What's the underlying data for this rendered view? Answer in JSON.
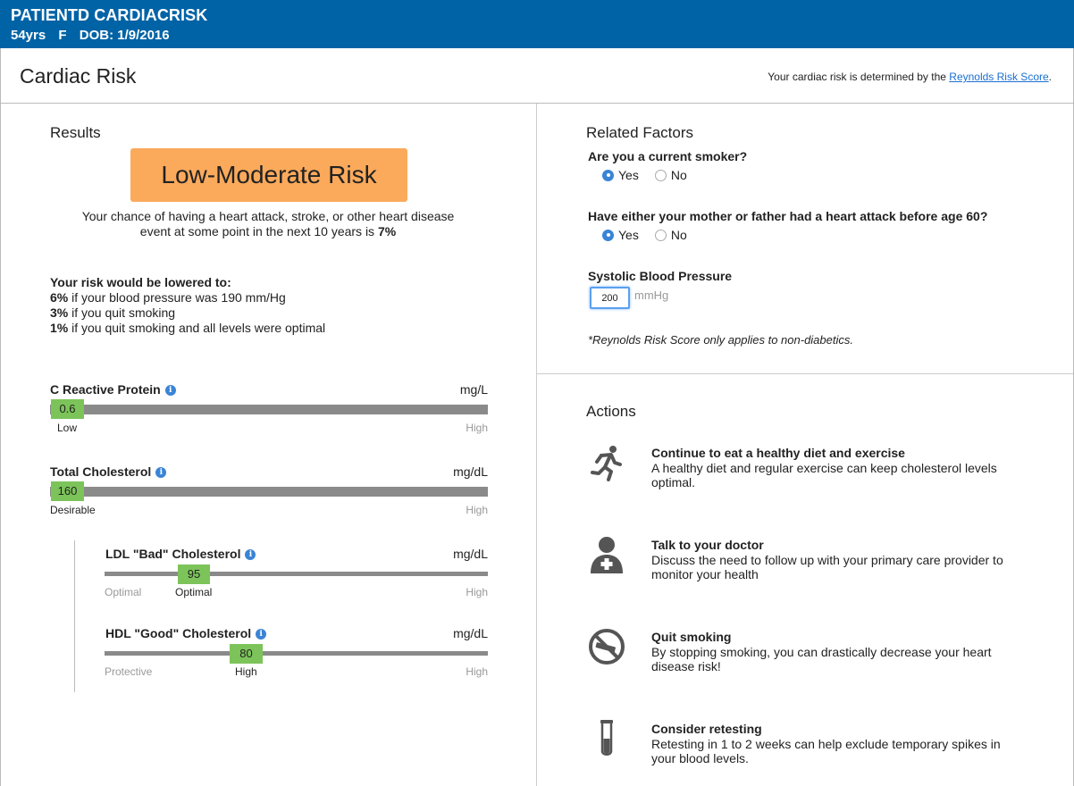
{
  "patient": {
    "name": "PATIENTD CARDIACRISK",
    "age": "54yrs",
    "sex": "F",
    "dob": "DOB: 1/9/2016"
  },
  "page": {
    "title": "Cardiac Risk",
    "note_prefix": "Your cardiac risk is determined by the",
    "note_link": "Reynolds Risk Score",
    "note_suffix": "."
  },
  "results": {
    "heading": "Results",
    "risk_label": "Low-Moderate Risk",
    "risk_color": "#fbaa5c",
    "chance_line1": "Your chance of having a heart attack, stroke, or other heart disease",
    "chance_line2_prefix": "event at some point in the next 10 years is",
    "chance_value": "7%",
    "lowered_heading": "Your risk would be lowered to:",
    "lowered": [
      {
        "value": "6%",
        "text": "if your blood pressure was 190 mm/Hg"
      },
      {
        "value": "3%",
        "text": "if you quit smoking"
      },
      {
        "value": "1%",
        "text": "if you quit smoking and all levels were optimal"
      }
    ]
  },
  "measures": {
    "crp": {
      "label": "C Reactive Protein",
      "unit": "mg/L",
      "value": "0.6",
      "left_label": "Low",
      "right_label": "High"
    },
    "total_chol": {
      "label": "Total Cholesterol",
      "unit": "mg/dL",
      "value": "160",
      "left_label": "Desirable",
      "right_label": "High"
    },
    "ldl": {
      "label": "LDL \"Bad\" Cholesterol",
      "unit": "mg/dL",
      "value": "95",
      "left_label": "Optimal",
      "mid_label": "Optimal",
      "right_label": "High"
    },
    "hdl": {
      "label": "HDL \"Good\" Cholesterol",
      "unit": "mg/dL",
      "value": "80",
      "left_label": "Protective",
      "mid_label": "High",
      "right_label": "High"
    }
  },
  "related": {
    "heading": "Related Factors",
    "q_smoker": "Are you a current smoker?",
    "q_parent": "Have either your mother or father had a heart attack before age 60?",
    "yes": "Yes",
    "no": "No",
    "smoker_selected": "Yes",
    "parent_selected": "Yes",
    "bp_label": "Systolic Blood Pressure",
    "bp_value": "200",
    "bp_unit": "mmHg",
    "disclaimer": "*Reynolds Risk Score only applies to non-diabetics."
  },
  "actions": {
    "heading": "Actions",
    "items": [
      {
        "icon": "running-person-icon",
        "title": "Continue to eat a healthy diet and exercise",
        "desc": "A healthy diet and regular exercise can keep cholesterol levels optimal."
      },
      {
        "icon": "doctor-icon",
        "title": "Talk to your doctor",
        "desc": "Discuss the need to follow up with your primary care provider to monitor your health"
      },
      {
        "icon": "no-smoking-icon",
        "title": "Quit smoking",
        "desc": "By stopping smoking, you can drastically decrease your heart disease risk!"
      },
      {
        "icon": "test-tube-icon",
        "title": "Consider retesting",
        "desc": "Retesting in 1 to 2 weeks can help exclude temporary spikes in your blood levels."
      }
    ]
  },
  "colors": {
    "header": "#0063a6",
    "value_box": "#7cc45a",
    "bar": "#8a8a8a",
    "link": "#1a6fd1"
  }
}
